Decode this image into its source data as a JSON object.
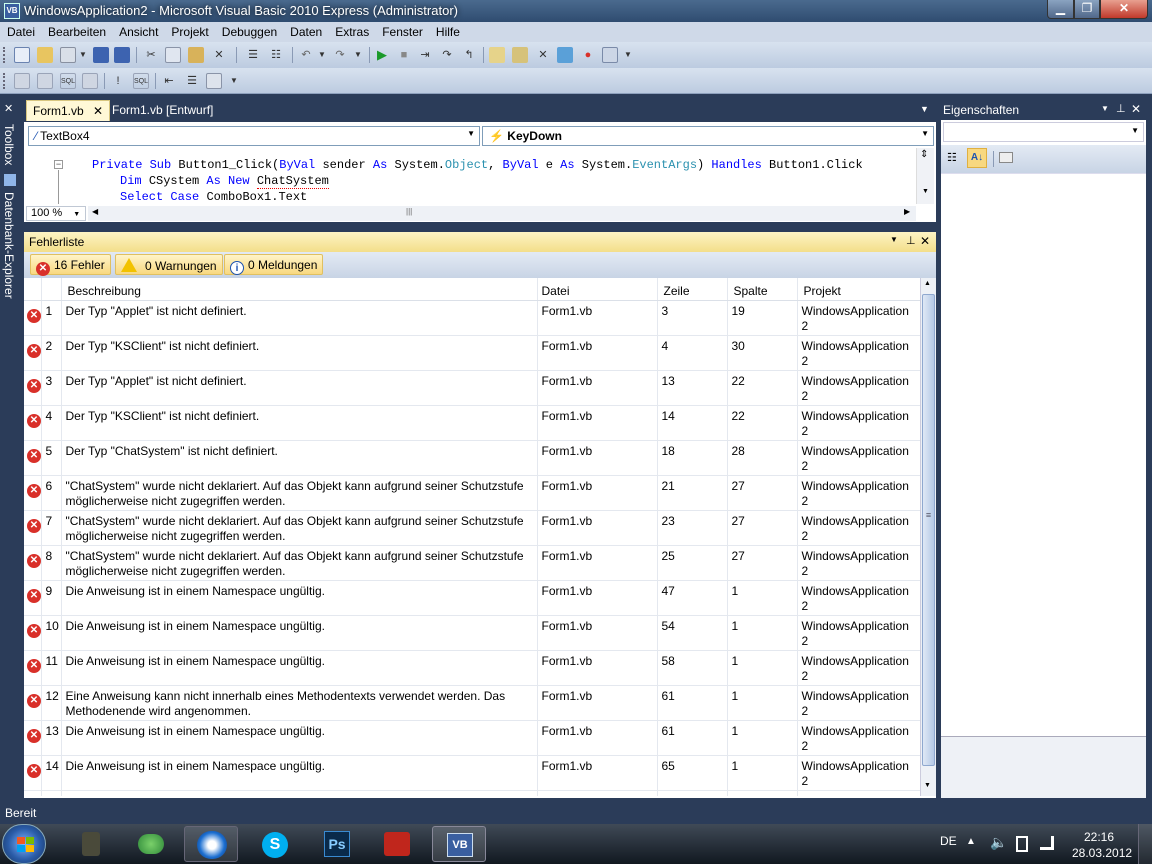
{
  "window": {
    "title": "WindowsApplication2 - Microsoft Visual Basic 2010 Express (Administrator)",
    "app_icon": "VB"
  },
  "menu": [
    "Datei",
    "Bearbeiten",
    "Ansicht",
    "Projekt",
    "Debuggen",
    "Daten",
    "Extras",
    "Fenster",
    "Hilfe"
  ],
  "side_strip": {
    "toolbox": "Toolbox",
    "db_explorer": "Datenbank-Explorer"
  },
  "tabs": [
    {
      "label": "Form1.vb",
      "active": true
    },
    {
      "label": "Form1.vb [Entwurf]",
      "active": false
    }
  ],
  "editor": {
    "object_combo": "TextBox4",
    "event_combo": "KeyDown",
    "zoom": "100 %",
    "lines": [
      {
        "indent": 0,
        "tokens": [
          {
            "t": "Private ",
            "c": "kw"
          },
          {
            "t": "Sub ",
            "c": "kw"
          },
          {
            "t": "Button1_Click(",
            "c": ""
          },
          {
            "t": "ByVal ",
            "c": "kw"
          },
          {
            "t": "sender ",
            "c": ""
          },
          {
            "t": "As ",
            "c": "kw"
          },
          {
            "t": "System.",
            "c": ""
          },
          {
            "t": "Object",
            "c": "ty"
          },
          {
            "t": ", ",
            "c": ""
          },
          {
            "t": "ByVal ",
            "c": "kw"
          },
          {
            "t": "e ",
            "c": ""
          },
          {
            "t": "As ",
            "c": "kw"
          },
          {
            "t": "System.",
            "c": ""
          },
          {
            "t": "EventArgs",
            "c": "ty"
          },
          {
            "t": ") ",
            "c": ""
          },
          {
            "t": "Handles ",
            "c": "kw"
          },
          {
            "t": "Button1.Click",
            "c": ""
          }
        ]
      },
      {
        "indent": 1,
        "tokens": [
          {
            "t": "Dim ",
            "c": "kw"
          },
          {
            "t": "CSystem ",
            "c": ""
          },
          {
            "t": "As ",
            "c": "kw"
          },
          {
            "t": "New ",
            "c": "kw"
          },
          {
            "t": "ChatSystem",
            "c": ""
          }
        ]
      },
      {
        "indent": 1,
        "tokens": [
          {
            "t": "Select ",
            "c": "kw"
          },
          {
            "t": "Case ",
            "c": "kw"
          },
          {
            "t": "ComboBox1.Text",
            "c": ""
          }
        ]
      }
    ]
  },
  "error_list": {
    "title": "Fehlerliste",
    "filters": {
      "errors": "16 Fehler",
      "warnings": "0 Warnungen",
      "messages": "0 Meldungen"
    },
    "columns": [
      "Beschreibung",
      "Datei",
      "Zeile",
      "Spalte",
      "Projekt"
    ],
    "rows": [
      {
        "n": "1",
        "desc": "Der Typ \"Applet\" ist nicht definiert.",
        "file": "Form1.vb",
        "line": "3",
        "col": "19",
        "proj": "WindowsApplication 2"
      },
      {
        "n": "2",
        "desc": "Der Typ \"KSClient\" ist nicht definiert.",
        "file": "Form1.vb",
        "line": "4",
        "col": "30",
        "proj": "WindowsApplication 2"
      },
      {
        "n": "3",
        "desc": "Der Typ \"Applet\" ist nicht definiert.",
        "file": "Form1.vb",
        "line": "13",
        "col": "22",
        "proj": "WindowsApplication 2"
      },
      {
        "n": "4",
        "desc": "Der Typ \"KSClient\" ist nicht definiert.",
        "file": "Form1.vb",
        "line": "14",
        "col": "22",
        "proj": "WindowsApplication 2"
      },
      {
        "n": "5",
        "desc": "Der Typ \"ChatSystem\" ist nicht definiert.",
        "file": "Form1.vb",
        "line": "18",
        "col": "28",
        "proj": "WindowsApplication 2"
      },
      {
        "n": "6",
        "desc": "\"ChatSystem\" wurde nicht deklariert. Auf das Objekt kann aufgrund seiner Schutzstufe möglicherweise nicht zugegriffen werden.",
        "file": "Form1.vb",
        "line": "21",
        "col": "27",
        "proj": "WindowsApplication 2"
      },
      {
        "n": "7",
        "desc": "\"ChatSystem\" wurde nicht deklariert. Auf das Objekt kann aufgrund seiner Schutzstufe möglicherweise nicht zugegriffen werden.",
        "file": "Form1.vb",
        "line": "23",
        "col": "27",
        "proj": "WindowsApplication 2"
      },
      {
        "n": "8",
        "desc": "\"ChatSystem\" wurde nicht deklariert. Auf das Objekt kann aufgrund seiner Schutzstufe möglicherweise nicht zugegriffen werden.",
        "file": "Form1.vb",
        "line": "25",
        "col": "27",
        "proj": "WindowsApplication 2"
      },
      {
        "n": "9",
        "desc": "Die Anweisung ist in einem Namespace ungültig.",
        "file": "Form1.vb",
        "line": "47",
        "col": "1",
        "proj": "WindowsApplication 2"
      },
      {
        "n": "10",
        "desc": "Die Anweisung ist in einem Namespace ungültig.",
        "file": "Form1.vb",
        "line": "54",
        "col": "1",
        "proj": "WindowsApplication 2"
      },
      {
        "n": "11",
        "desc": "Die Anweisung ist in einem Namespace ungültig.",
        "file": "Form1.vb",
        "line": "58",
        "col": "1",
        "proj": "WindowsApplication 2"
      },
      {
        "n": "12",
        "desc": "Eine Anweisung kann nicht innerhalb eines Methodentexts verwendet werden. Das Methodenende wird angenommen.",
        "file": "Form1.vb",
        "line": "61",
        "col": "1",
        "proj": "WindowsApplication 2"
      },
      {
        "n": "13",
        "desc": "Die Anweisung ist in einem Namespace ungültig.",
        "file": "Form1.vb",
        "line": "61",
        "col": "1",
        "proj": "WindowsApplication 2"
      },
      {
        "n": "14",
        "desc": "Die Anweisung ist in einem Namespace ungültig.",
        "file": "Form1.vb",
        "line": "65",
        "col": "1",
        "proj": "WindowsApplication 2"
      },
      {
        "n": "",
        "desc": "",
        "file": "",
        "line": "",
        "col": "",
        "proj": ""
      }
    ]
  },
  "properties": {
    "title": "Eigenschaften"
  },
  "status": "Bereit",
  "taskbar": {
    "items": [
      "Photoshop",
      "Visual Basic"
    ],
    "ps_label": "Ps",
    "vb_label": "VB",
    "lang": "DE",
    "time": "22:16",
    "date": "28.03.2012"
  },
  "colors": {
    "keyword": "#0000ff",
    "type": "#2b91af",
    "error_icon": "#d9302a"
  }
}
